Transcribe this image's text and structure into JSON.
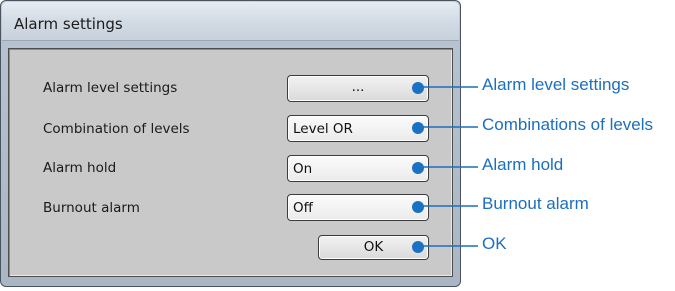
{
  "dialog": {
    "title": "Alarm settings",
    "rows": [
      {
        "label": "Alarm level settings",
        "value": "..."
      },
      {
        "label": "Combination of levels",
        "value": "Level OR"
      },
      {
        "label": "Alarm hold",
        "value": "On"
      },
      {
        "label": "Burnout alarm",
        "value": "Off"
      }
    ],
    "ok_label": "OK"
  },
  "callouts": [
    "Alarm level settings",
    "Combinations of levels",
    "Alarm hold",
    "Burnout alarm",
    "OK"
  ],
  "colors": {
    "callout": "#1b6fbf",
    "marker": "#1a72c2"
  }
}
